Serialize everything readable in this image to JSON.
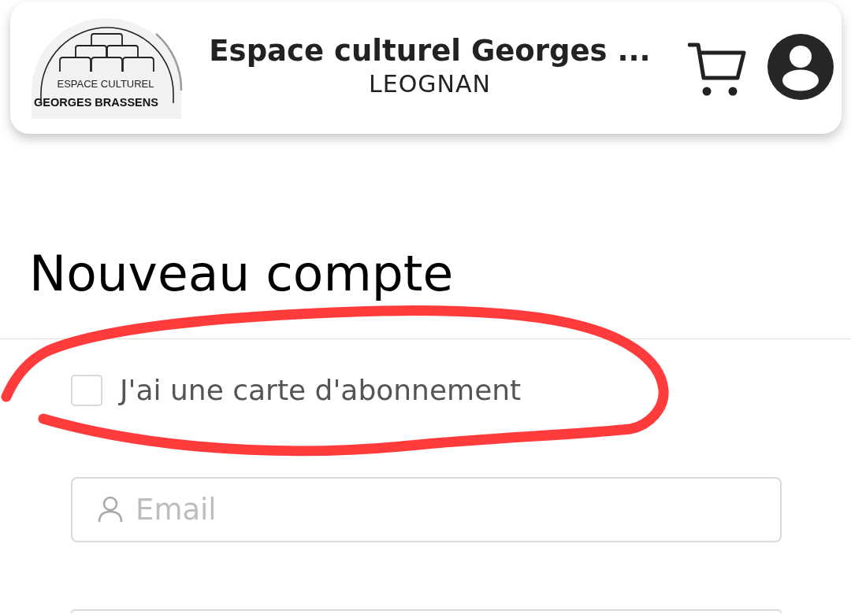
{
  "header": {
    "logo": {
      "lines": [
        "ESPACE CULTUREL",
        "GEORGES BRASSENS"
      ]
    },
    "title": "Espace culturel Georges ...",
    "subtitle": "LEOGNAN"
  },
  "page": {
    "heading": "Nouveau compte"
  },
  "subscription_checkbox": {
    "label": "J'ai une carte d'abonnement",
    "checked": false
  },
  "fields": [
    {
      "kind": "email",
      "placeholder": "Email"
    },
    {
      "kind": "blank"
    }
  ]
}
